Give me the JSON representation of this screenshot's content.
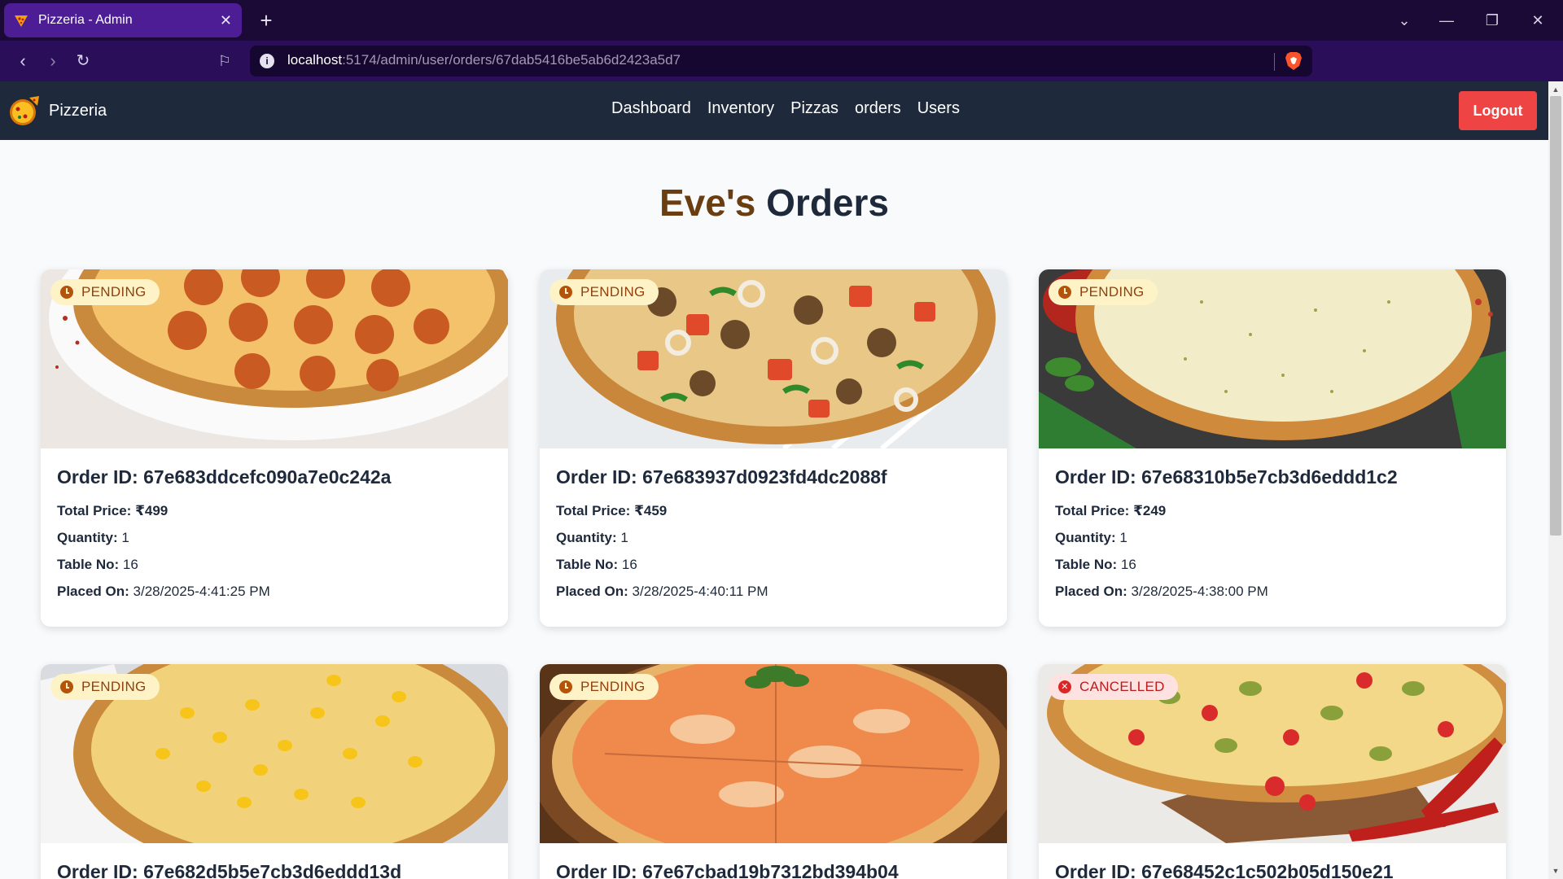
{
  "browser": {
    "tab_title": "Pizzeria - Admin",
    "url_host": "localhost",
    "url_rest": ":5174/admin/user/orders/67dab5416be5ab6d2423a5d7"
  },
  "header": {
    "brand": "Pizzeria",
    "nav": [
      "Dashboard",
      "Inventory",
      "Pizzas",
      "orders",
      "Users"
    ],
    "logout_label": "Logout"
  },
  "page": {
    "title_owner": "Eve's",
    "title_rest": "Orders"
  },
  "labels": {
    "order_id": "Order ID:",
    "total_price": "Total Price:",
    "quantity": "Quantity:",
    "table_no": "Table No:",
    "placed_on": "Placed On:"
  },
  "orders": [
    {
      "id": "67e683ddcefc090a7e0c242a",
      "status": "PENDING",
      "total": "₹499",
      "quantity": "1",
      "table": "16",
      "placed": "3/28/2025-4:41:25 PM",
      "pizza": "pepperoni"
    },
    {
      "id": "67e683937d0923fd4dc2088f",
      "status": "PENDING",
      "total": "₹459",
      "quantity": "1",
      "table": "16",
      "placed": "3/28/2025-4:40:11 PM",
      "pizza": "veggie"
    },
    {
      "id": "67e68310b5e7cb3d6eddd1c2",
      "status": "PENDING",
      "total": "₹249",
      "quantity": "1",
      "table": "16",
      "placed": "3/28/2025-4:38:00 PM",
      "pizza": "cheese"
    },
    {
      "id": "67e682d5b5e7cb3d6eddd13d",
      "status": "PENDING",
      "pizza": "corn"
    },
    {
      "id": "67e67cbad19b7312bd394b04",
      "status": "PENDING",
      "pizza": "margherita"
    },
    {
      "id": "67e68452c1c502b05d150e21",
      "status": "CANCELLED",
      "pizza": "jalapeno"
    }
  ]
}
